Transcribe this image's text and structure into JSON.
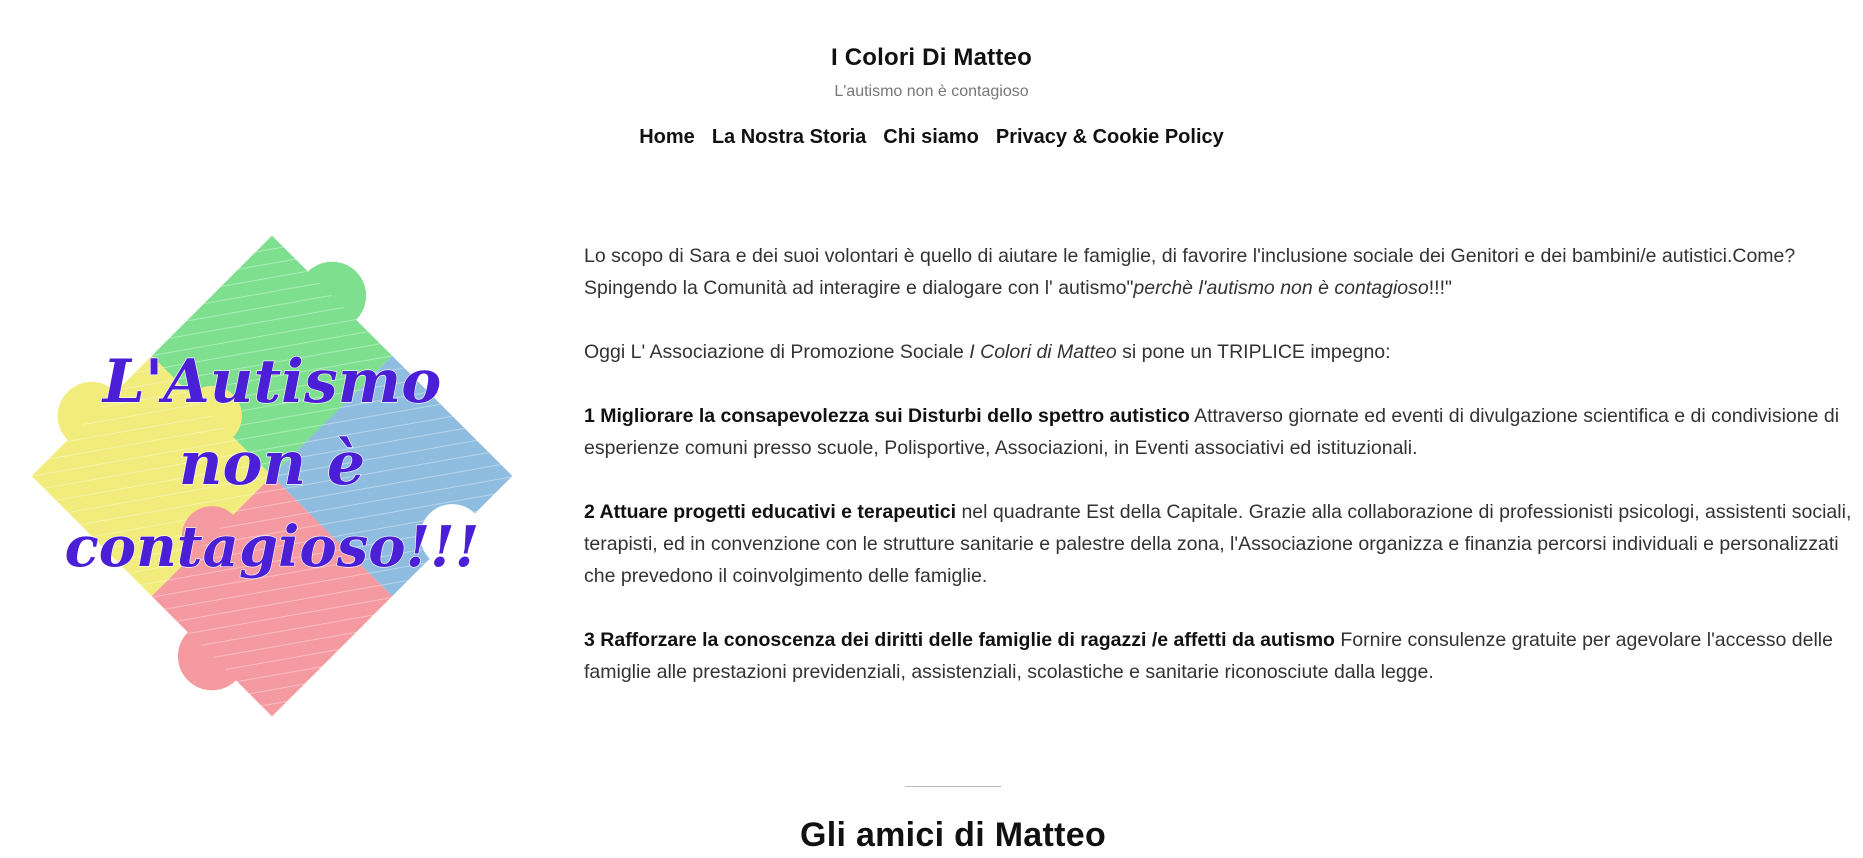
{
  "site": {
    "title": "I Colori Di Matteo",
    "tagline": "L'autismo non è contagioso"
  },
  "nav": {
    "items": [
      {
        "label": "Home"
      },
      {
        "label": "La Nostra Storia"
      },
      {
        "label": "Chi siamo"
      },
      {
        "label": "Privacy & Cookie Policy"
      }
    ]
  },
  "hero_image": {
    "icon": "puzzle-pieces-image",
    "text_lines": [
      "L'Autismo",
      "non è",
      "contagioso!!!"
    ],
    "colors": {
      "green": "#7ee08e",
      "blue": "#8fbde0",
      "yellow": "#f1ec7b",
      "pink": "#f59aa0",
      "text": "#4a1fd6"
    }
  },
  "content": {
    "intro": {
      "part1": "Lo scopo di Sara e dei suoi volontari è quello di aiutare le famiglie, di favorire l'inclusione sociale dei Genitori e dei bambini/e autistici.Come? Spingendo la Comunità ad interagire e dialogare con l' autismo\"",
      "emphasis": "perchè l'autismo non è contagioso",
      "part2": "!!!\""
    },
    "commitment": {
      "before": "Oggi L' Associazione di Promozione Sociale ",
      "emphasis": "I Colori di Matteo",
      "after": " si pone un TRIPLICE impegno:"
    },
    "points": [
      {
        "title": "1 Migliorare la consapevolezza sui Disturbi dello spettro autistico",
        "text": " Attraverso giornate ed eventi di divulgazione scientifica e di condivisione di esperienze comuni presso scuole, Polisportive, Associazioni, in Eventi associativi ed istituzionali."
      },
      {
        "title": "2 Attuare progetti educativi e terapeutici",
        "text": " nel quadrante Est della Capitale. Grazie alla collaborazione di professionisti psicologi, assistenti sociali, terapisti, ed in convenzione con le strutture sanitarie e palestre della zona, l'Associazione organizza e finanzia percorsi individuali e personalizzati che prevedono il coinvolgimento delle famiglie."
      },
      {
        "title": "3 Rafforzare la conoscenza dei diritti delle famiglie di ragazzi /e affetti da autismo",
        "text": " Fornire consulenze gratuite per agevolare l'accesso delle famiglie alle prestazioni previdenziali, assistenziali, scolastiche e sanitarie riconosciute dalla legge."
      }
    ]
  },
  "section": {
    "title": "Gli amici di Matteo"
  }
}
